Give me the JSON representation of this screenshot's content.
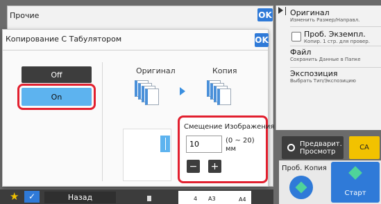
{
  "outer_dialog": {
    "title": "Прочие",
    "ok_label": "OK"
  },
  "dialog": {
    "title": "Копирование С Табулятором",
    "ok_label": "OK",
    "off_label": "Off",
    "on_label": "On",
    "original_label": "Оригинал",
    "copy_label": "Копия",
    "image_shift": {
      "title": "Смещение Изображения",
      "value": "10",
      "range": "(0 ~ 20)",
      "unit": "мм",
      "minus": "−",
      "plus": "+"
    }
  },
  "right_panel": {
    "items": [
      {
        "title": "Оригинал",
        "subtitle": "Изменить Размер/Направл."
      },
      {
        "title": "Проб. Экземпл.",
        "subtitle": "Копир. 1 стр. для провер."
      },
      {
        "title": "Файл",
        "subtitle": "Сохранить Данные в Папке"
      },
      {
        "title": "Экспозиция",
        "subtitle": "Выбрать Тип/Экспозицию"
      }
    ],
    "preview_label_1": "Предварит.",
    "preview_label_2": "Просмотр",
    "ca_label": "CA",
    "proof_copy_label": "Проб. Копия",
    "start_label": "Старт"
  },
  "bottom_bar": {
    "back_label": "Назад",
    "paper_count": "4",
    "paper_size_1": "A3",
    "paper_size_2": "A4"
  },
  "colors": {
    "accent": "#2f7ad8",
    "highlight": "#e2202f",
    "selected": "#5db3ef",
    "ca": "#f2c200"
  }
}
